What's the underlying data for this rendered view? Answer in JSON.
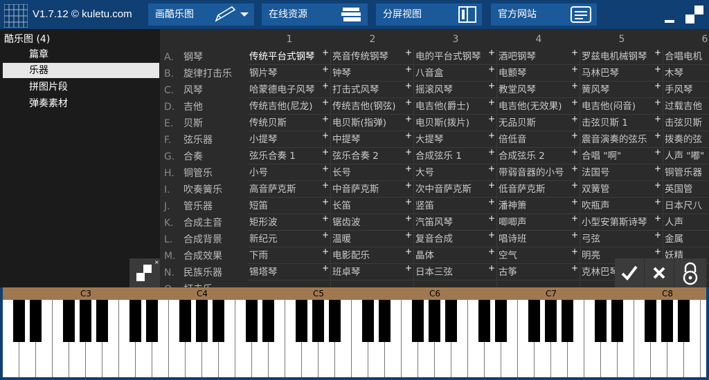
{
  "header": {
    "version": "V1.7.12 © kuletu.com"
  },
  "toolbar": {
    "draw": "画酷乐图",
    "online": "在线资源",
    "split": "分屏视图",
    "official": "官方网站"
  },
  "tree": {
    "root": "酷乐图 (4)",
    "items": [
      "篇章",
      "乐器",
      "拼图片段",
      "弹奏素材"
    ],
    "selected_index": 1
  },
  "grid": {
    "columns": [
      "1",
      "2",
      "3",
      "4",
      "5",
      "6"
    ],
    "rows": [
      {
        "letter": "A.",
        "name": "钢琴",
        "cells": [
          "传统平台式钢琴",
          "亮音传统钢琴",
          "电的平台式钢琴",
          "酒吧钢琴",
          "罗兹电机械钢琴",
          "合唱电机"
        ]
      },
      {
        "letter": "B.",
        "name": "旋律打击乐",
        "cells": [
          "钢片琴",
          "钟琴",
          "八音盒",
          "电颤琴",
          "马林巴琴",
          "木琴"
        ]
      },
      {
        "letter": "C.",
        "name": "风琴",
        "cells": [
          "哈蒙德电子风琴",
          "打击式风琴",
          "摇滚风琴",
          "教堂风琴",
          "簧风琴",
          "手风琴"
        ]
      },
      {
        "letter": "D.",
        "name": "吉他",
        "cells": [
          "传统吉他(尼龙)",
          "传统吉他(钢弦)",
          "电吉他(爵士)",
          "电吉他(无效果)",
          "电吉他(闷音)",
          "过载吉他"
        ]
      },
      {
        "letter": "E.",
        "name": "贝斯",
        "cells": [
          "传统贝斯",
          "电贝斯(指弹)",
          "电贝斯(拨片)",
          "无品贝斯",
          "击弦贝斯 1",
          "击弦贝斯"
        ]
      },
      {
        "letter": "F.",
        "name": "弦乐器",
        "cells": [
          "小提琴",
          "中提琴",
          "大提琴",
          "倍低音",
          "震音演奏的弦乐",
          "拨奏的弦"
        ]
      },
      {
        "letter": "G.",
        "name": "合奏",
        "cells": [
          "弦乐合奏 1",
          "弦乐合奏 2",
          "合成弦乐 1",
          "合成弦乐 2",
          "合唱 \"啊\"",
          "人声 \"嘟\""
        ]
      },
      {
        "letter": "H.",
        "name": "铜管乐",
        "cells": [
          "小号",
          "长号",
          "大号",
          "带弱音器的小号",
          "法国号",
          "铜管乐器"
        ]
      },
      {
        "letter": "I.",
        "name": "吹奏簧乐",
        "cells": [
          "高音萨克斯",
          "中音萨克斯",
          "次中音萨克斯",
          "低音萨克斯",
          "双簧管",
          "英国管"
        ]
      },
      {
        "letter": "J.",
        "name": "管乐器",
        "cells": [
          "短笛",
          "长笛",
          "竖笛",
          "潘神箫",
          "吹瓶声",
          "日本尺八"
        ]
      },
      {
        "letter": "K.",
        "name": "合成主音",
        "cells": [
          "矩形波",
          "锯齿波",
          "汽笛风琴",
          "唧唧声",
          "小型安第斯诗琴",
          "人声"
        ]
      },
      {
        "letter": "L.",
        "name": "合成背景",
        "cells": [
          "新纪元",
          "温暖",
          "复音合成",
          "唱诗班",
          "弓弦",
          "金属"
        ]
      },
      {
        "letter": "M.",
        "name": "合成效果",
        "cells": [
          "下雨",
          "电影配乐",
          "晶体",
          "空气",
          "明亮",
          "妖精"
        ]
      },
      {
        "letter": "N.",
        "name": "民族乐器",
        "cells": [
          "锡塔琴",
          "班卓琴",
          "日本三弦",
          "古筝",
          "克林巴琴",
          ""
        ]
      },
      {
        "letter": "O.",
        "name": "打击乐",
        "cells": [
          "",
          "",
          "",
          "",
          "",
          ""
        ]
      }
    ],
    "highlight": {
      "row": 0,
      "col": 0
    }
  },
  "piano": {
    "octave_labels": [
      "C3",
      "C4",
      "C5",
      "C6",
      "C7",
      "C8"
    ]
  },
  "colors": {
    "bg": "#0f3f73",
    "button": "#1a5a9b",
    "grid": "#2b2b2b",
    "ruler": "#a07850"
  }
}
